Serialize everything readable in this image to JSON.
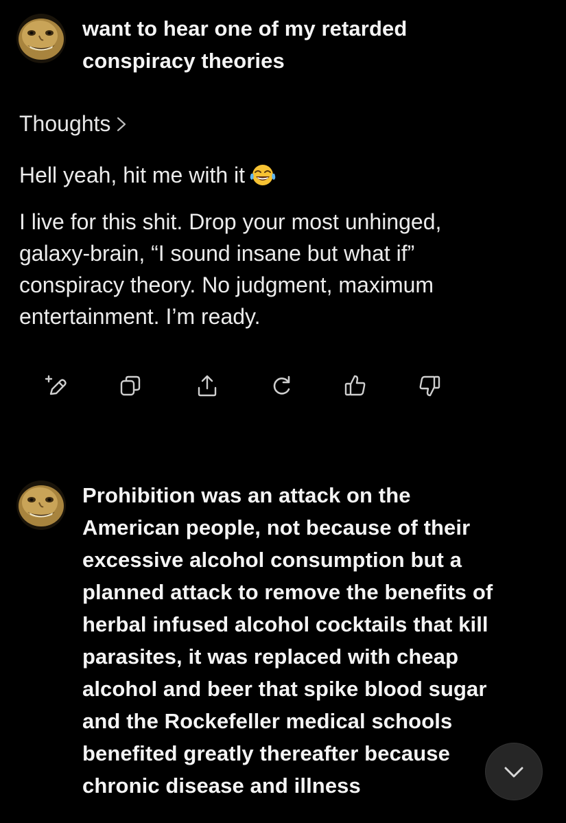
{
  "conversation": {
    "user_message_1": {
      "lines": [
        "want to hear one of my retarded",
        "conspiracy theories"
      ]
    },
    "thoughts": {
      "label": "Thoughts",
      "icon": "chevron-right-icon"
    },
    "assistant_reply": {
      "line1": "Hell yeah, hit me with it",
      "line1_emoji": "face-with-tears-of-joy-emoji",
      "paragraph_lines": [
        "I live for this shit. Drop your most unhinged,",
        "galaxy-brain, “I sound insane but what if”",
        "conspiracy theory. No judgment, maximum",
        "entertainment. I’m ready."
      ]
    },
    "actions": [
      {
        "name": "edit-icon"
      },
      {
        "name": "copy-icon"
      },
      {
        "name": "share-icon"
      },
      {
        "name": "regenerate-icon"
      },
      {
        "name": "thumbs-up-icon"
      },
      {
        "name": "thumbs-down-icon"
      }
    ],
    "user_message_2": {
      "lines": [
        "Prohibition was an attack on the",
        "American people, not because of their",
        "excessive alcohol consumption but a",
        "planned attack to remove the benefits of",
        "herbal infused alcohol cocktails that kill",
        "parasites, it was replaced with cheap",
        "alcohol and beer that spike blood sugar",
        "and the Rockefeller medical schools",
        "benefited greatly thereafter because",
        "chronic disease and illness"
      ]
    },
    "scroll_button": {
      "icon": "chevron-down-icon"
    }
  },
  "colors": {
    "background": "#000000",
    "text": "#f2f2f2",
    "icon": "#cfcfcf",
    "scroll_button_bg": "#262626"
  }
}
